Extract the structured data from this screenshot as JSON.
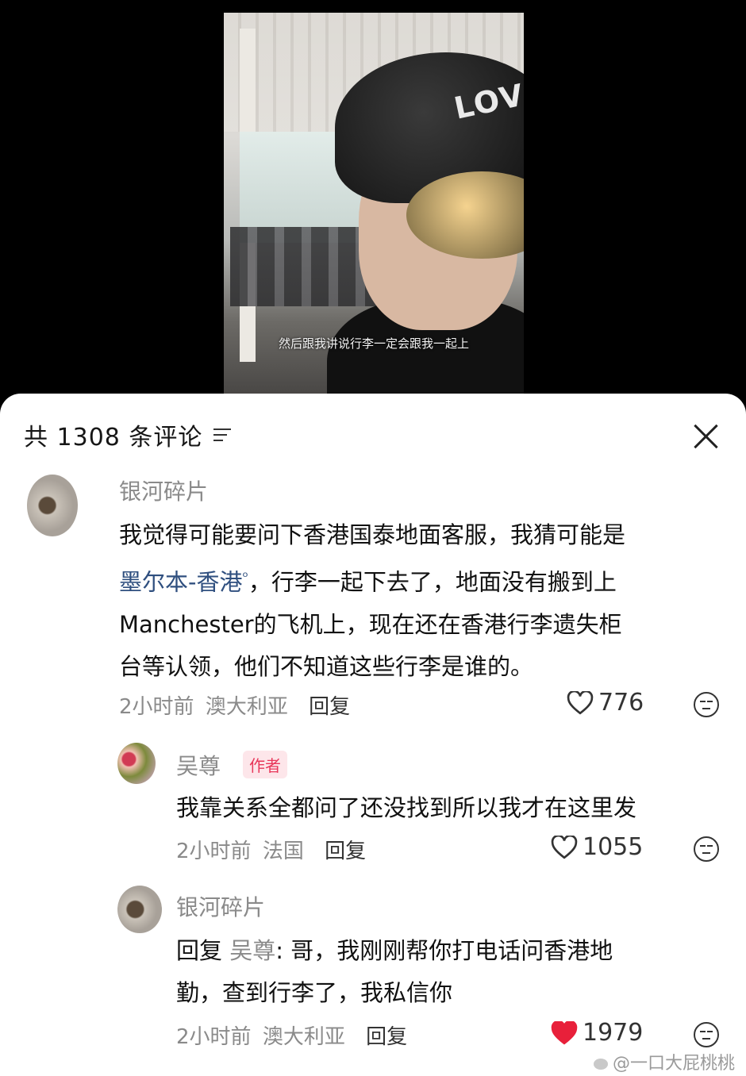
{
  "video": {
    "subtitle": "然后跟我讲说行李一定会跟我一起上",
    "cap_text": "LOV"
  },
  "comments_panel": {
    "title": "共 1308 条评论",
    "filter_icon": "filter-icon",
    "close_icon": "close-icon"
  },
  "comments": [
    {
      "username": "银河碎片",
      "lines": [
        "我觉得可能要问下香港国泰地面客服，我猜可能是",
        "，行李一起下去了，地面没有搬到上",
        "Manchester的飞机上，现在还在香港行李遗失柜",
        "台等认领，他们不知道这些行李是谁的。"
      ],
      "link": "墨尔本-香港",
      "time": "2小时前",
      "location": "澳大利亚",
      "reply": "回复",
      "likes": "776",
      "liked": false
    },
    {
      "username": "吴尊",
      "author_tag": "作者",
      "text": "我靠关系全都问了还没找到所以我才在这里发",
      "time": "2小时前",
      "location": "法国",
      "reply": "回复",
      "likes": "1055",
      "liked": false
    },
    {
      "username": "银河碎片",
      "reply_prefix": "回复",
      "reply_to": "吴尊",
      "lines": [
        ": 哥，我刚刚帮你打电话问香港地",
        "勤，查到行李了，我私信你"
      ],
      "time": "2小时前",
      "location": "澳大利亚",
      "reply": "回复",
      "likes": "1979",
      "liked": true
    }
  ],
  "watermark": "@一口大屁桃桃",
  "colors": {
    "liked_heart": "#e8203a",
    "link": "#2f4f7f",
    "author_tag": "#e8375a"
  }
}
